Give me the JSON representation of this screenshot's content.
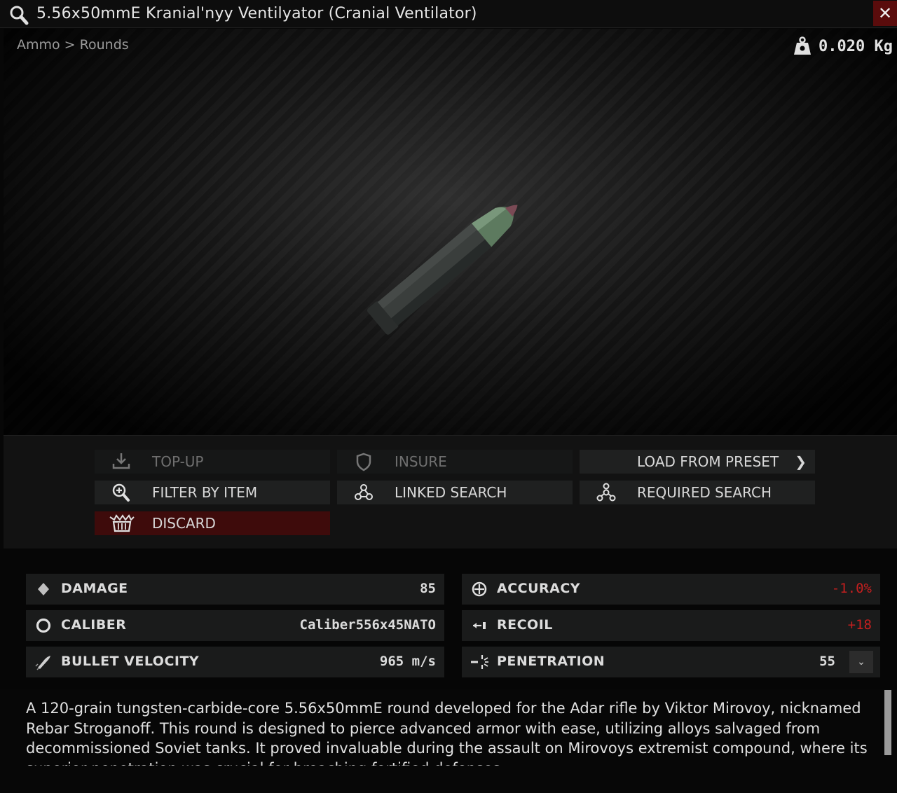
{
  "window": {
    "title": "5.56x50mmE Kranial'nyy Ventilyator (Cranial Ventilator)",
    "close_label": "✕"
  },
  "viewer": {
    "breadcrumb": "Ammo > Rounds",
    "weight": "0.020 Kg"
  },
  "actions": [
    {
      "label": "TOP-UP",
      "icon": "download-icon",
      "enabled": false
    },
    {
      "label": "INSURE",
      "icon": "shield-icon",
      "enabled": false
    },
    {
      "label": "LOAD FROM PRESET",
      "icon": "",
      "enabled": true
    },
    {
      "label": "FILTER BY ITEM",
      "icon": "magnifier-plus-icon",
      "enabled": true
    },
    {
      "label": "LINKED SEARCH",
      "icon": "linked-search-icon",
      "enabled": true
    },
    {
      "label": "REQUIRED SEARCH",
      "icon": "required-search-icon",
      "enabled": true
    },
    {
      "label": "DISCARD",
      "icon": "trash-icon",
      "enabled": true
    }
  ],
  "stats": {
    "damage": {
      "label": "DAMAGE",
      "value": "85"
    },
    "caliber": {
      "label": "CALIBER",
      "value": "Caliber556x45NATO"
    },
    "velocity": {
      "label": "BULLET VELOCITY",
      "value": "965 m/s"
    },
    "accuracy": {
      "label": "ACCURACY",
      "value": "-1.0%"
    },
    "recoil": {
      "label": "RECOIL",
      "value": "+18"
    },
    "penetration": {
      "label": "PENETRATION",
      "value": "55"
    }
  },
  "description": "A 120-grain tungsten-carbide-core 5.56x50mmE round developed for the Adar rifle by Viktor Mirovoy, nicknamed Rebar Stroganoff. This round is designed to pierce advanced armor with ease, utilizing alloys salvaged from decommissioned Soviet tanks. It proved invaluable during the assault on Mirovoys extremist compound, where its superior penetration was crucial for breaching fortified defenses.",
  "colors": {
    "negative": "#c41f1f",
    "discard_bg": "#3e0b0b",
    "close_bg": "#5a0c0c",
    "bullet_tip": "#6e8a6e"
  }
}
